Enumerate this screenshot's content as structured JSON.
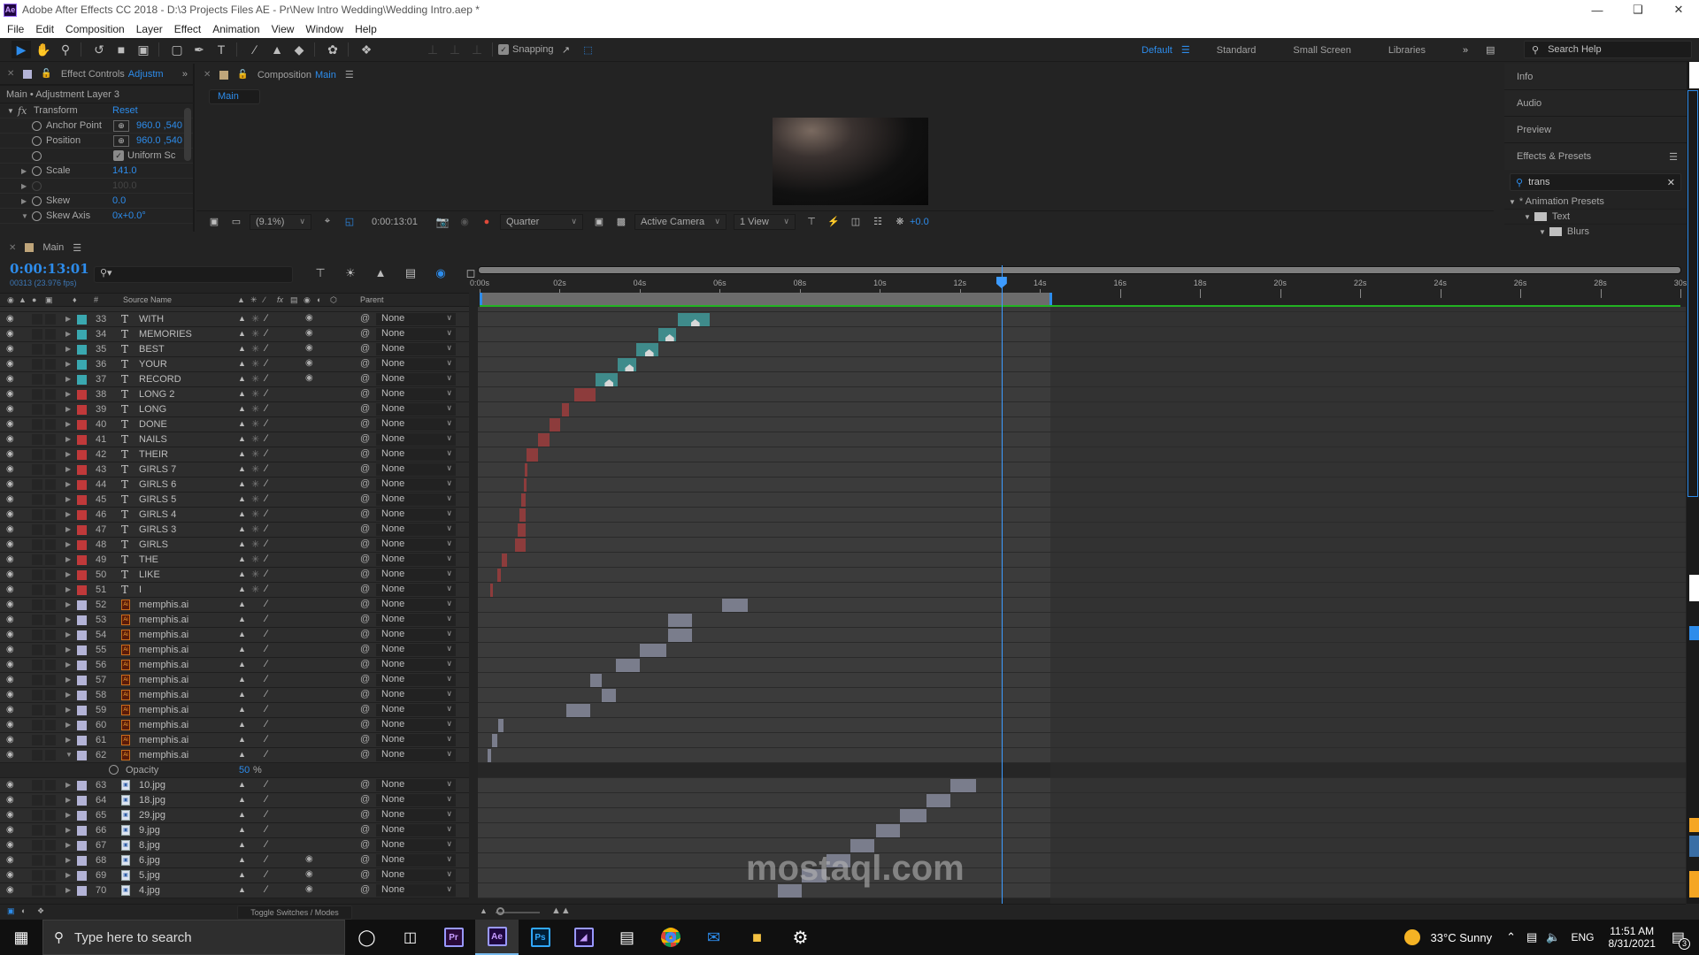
{
  "app": {
    "title": "Adobe After Effects CC 2018 - D:\\3 Projects Files AE - Pr\\New Intro Wedding\\Wedding Intro.aep *",
    "logo": "Ae"
  },
  "menu": [
    "File",
    "Edit",
    "Composition",
    "Layer",
    "Effect",
    "Animation",
    "View",
    "Window",
    "Help"
  ],
  "toolbar": {
    "snapping_label": "Snapping",
    "snapping_checked": true,
    "workspaces": [
      "Default",
      "Standard",
      "Small Screen",
      "Libraries"
    ],
    "active_workspace": "Default",
    "search_help_placeholder": "Search Help"
  },
  "effect_controls": {
    "tab_label": "Effect Controls",
    "tab_target": "Adjustm",
    "layer_path": "Main • Adjustment Layer 3",
    "effect_name": "Transform",
    "reset_label": "Reset",
    "props": [
      {
        "label": "Anchor Point",
        "value": "960.0 ,540"
      },
      {
        "label": "Position",
        "value": "960.0 ,540"
      },
      {
        "label": "",
        "value": "Uniform Sc",
        "checkbox": true
      },
      {
        "label": "Scale",
        "value": "141.0"
      },
      {
        "label": "",
        "value": "100.0"
      },
      {
        "label": "Skew",
        "value": "0.0"
      },
      {
        "label": "Skew Axis",
        "value": "0x+0.0°"
      }
    ]
  },
  "composition": {
    "tab_label": "Composition",
    "tab_target": "Main",
    "breadcrumb": "Main",
    "zoom": "(9.1%)",
    "timecode": "0:00:13:01",
    "resolution": "Quarter",
    "camera": "Active Camera",
    "views": "1 View",
    "exposure": "+0.0"
  },
  "right_panel": {
    "sections": [
      "Info",
      "Audio",
      "Preview",
      "Effects & Presets"
    ],
    "effects_search": "trans",
    "tree": [
      {
        "label": "* Animation Presets",
        "level": 0
      },
      {
        "label": "Text",
        "level": 1
      },
      {
        "label": "Blurs",
        "level": 2
      }
    ]
  },
  "timeline": {
    "tab_label": "Main",
    "timecode": "0:00:13:01",
    "frames": "00313 (23.976 fps)",
    "search_placeholder": "",
    "columns": {
      "num": "#",
      "source": "Source Name",
      "parent": "Parent"
    },
    "ruler_ticks": [
      "0:00s",
      "02s",
      "04s",
      "06s",
      "08s",
      "10s",
      "12s",
      "14s",
      "16s",
      "18s",
      "20s",
      "22s",
      "24s",
      "26s",
      "28s",
      "30s"
    ],
    "duration_s": 30,
    "current_time_s": 13.04,
    "work_area_end_s": 14.3,
    "toggle_label": "Toggle Switches / Modes",
    "layers": [
      {
        "num": "33",
        "type": "text",
        "name": "WITH",
        "color": "#3aa8b0",
        "parent": "None",
        "in": 5.0,
        "out": 5.8,
        "kind": "teal"
      },
      {
        "num": "34",
        "type": "text",
        "name": "MEMORIES",
        "color": "#3aa8b0",
        "parent": "None",
        "in": 4.5,
        "out": 4.95,
        "kind": "teal"
      },
      {
        "num": "35",
        "type": "text",
        "name": "BEST",
        "color": "#3aa8b0",
        "parent": "None",
        "in": 3.95,
        "out": 4.5,
        "kind": "teal"
      },
      {
        "num": "36",
        "type": "text",
        "name": "YOUR",
        "color": "#3aa8b0",
        "parent": "None",
        "in": 3.5,
        "out": 3.95,
        "kind": "teal"
      },
      {
        "num": "37",
        "type": "text",
        "name": "RECORD",
        "color": "#3aa8b0",
        "parent": "None",
        "in": 2.95,
        "out": 3.5,
        "kind": "teal"
      },
      {
        "num": "38",
        "type": "text",
        "name": "LONG 2",
        "color": "#c0393a",
        "parent": "None",
        "in": 2.42,
        "out": 2.93,
        "kind": "red"
      },
      {
        "num": "39",
        "type": "text",
        "name": "LONG",
        "color": "#c0393a",
        "parent": "None",
        "in": 2.1,
        "out": 2.28,
        "kind": "red"
      },
      {
        "num": "40",
        "type": "text",
        "name": "DONE",
        "color": "#c0393a",
        "parent": "None",
        "in": 1.8,
        "out": 2.05,
        "kind": "red"
      },
      {
        "num": "41",
        "type": "text",
        "name": "NAILS",
        "color": "#c0393a",
        "parent": "None",
        "in": 1.5,
        "out": 1.8,
        "kind": "red"
      },
      {
        "num": "42",
        "type": "text",
        "name": "THEIR",
        "color": "#c0393a",
        "parent": "None",
        "in": 1.22,
        "out": 1.5,
        "kind": "red"
      },
      {
        "num": "43",
        "type": "text",
        "name": "GIRLS 7",
        "color": "#c0393a",
        "parent": "None",
        "in": 1.18,
        "out": 1.22,
        "kind": "red"
      },
      {
        "num": "44",
        "type": "text",
        "name": "GIRLS 6",
        "color": "#c0393a",
        "parent": "None",
        "in": 1.14,
        "out": 1.2,
        "kind": "red"
      },
      {
        "num": "45",
        "type": "text",
        "name": "GIRLS 5",
        "color": "#c0393a",
        "parent": "None",
        "in": 1.08,
        "out": 1.2,
        "kind": "red"
      },
      {
        "num": "46",
        "type": "text",
        "name": "GIRLS 4",
        "color": "#c0393a",
        "parent": "None",
        "in": 1.04,
        "out": 1.2,
        "kind": "red"
      },
      {
        "num": "47",
        "type": "text",
        "name": "GIRLS 3",
        "color": "#c0393a",
        "parent": "None",
        "in": 0.99,
        "out": 1.2,
        "kind": "red"
      },
      {
        "num": "48",
        "type": "text",
        "name": "GIRLS",
        "color": "#c0393a",
        "parent": "None",
        "in": 0.92,
        "out": 1.2,
        "kind": "red"
      },
      {
        "num": "49",
        "type": "text",
        "name": "THE",
        "color": "#c0393a",
        "parent": "None",
        "in": 0.6,
        "out": 0.72,
        "kind": "red"
      },
      {
        "num": "50",
        "type": "text",
        "name": "LIKE",
        "color": "#c0393a",
        "parent": "None",
        "in": 0.48,
        "out": 0.58,
        "kind": "red"
      },
      {
        "num": "51",
        "type": "text",
        "name": "I",
        "color": "#c0393a",
        "parent": "None",
        "in": 0.3,
        "out": 0.36,
        "kind": "red"
      },
      {
        "num": "52",
        "type": "ai",
        "name": "memphis.ai",
        "color": "#b3b3d6",
        "parent": "None",
        "in": 6.1,
        "out": 6.75,
        "kind": "gray"
      },
      {
        "num": "53",
        "type": "ai",
        "name": "memphis.ai",
        "color": "#b3b3d6",
        "parent": "None",
        "in": 4.75,
        "out": 5.35,
        "kind": "gray"
      },
      {
        "num": "54",
        "type": "ai",
        "name": "memphis.ai",
        "color": "#b3b3d6",
        "parent": "None",
        "in": 4.75,
        "out": 5.35,
        "kind": "gray"
      },
      {
        "num": "55",
        "type": "ai",
        "name": "memphis.ai",
        "color": "#b3b3d6",
        "parent": "None",
        "in": 4.05,
        "out": 4.7,
        "kind": "gray"
      },
      {
        "num": "56",
        "type": "ai",
        "name": "memphis.ai",
        "color": "#b3b3d6",
        "parent": "None",
        "in": 3.45,
        "out": 4.05,
        "kind": "gray"
      },
      {
        "num": "57",
        "type": "ai",
        "name": "memphis.ai",
        "color": "#b3b3d6",
        "parent": "None",
        "in": 2.8,
        "out": 3.1,
        "kind": "gray"
      },
      {
        "num": "58",
        "type": "ai",
        "name": "memphis.ai",
        "color": "#b3b3d6",
        "parent": "None",
        "in": 3.1,
        "out": 3.45,
        "kind": "gray"
      },
      {
        "num": "59",
        "type": "ai",
        "name": "memphis.ai",
        "color": "#b3b3d6",
        "parent": "None",
        "in": 2.2,
        "out": 2.8,
        "kind": "gray"
      },
      {
        "num": "60",
        "type": "ai",
        "name": "memphis.ai",
        "color": "#b3b3d6",
        "parent": "None",
        "in": 0.5,
        "out": 0.65,
        "kind": "gray"
      },
      {
        "num": "61",
        "type": "ai",
        "name": "memphis.ai",
        "color": "#b3b3d6",
        "parent": "None",
        "in": 0.35,
        "out": 0.48,
        "kind": "gray"
      },
      {
        "num": "62",
        "type": "ai",
        "name": "memphis.ai",
        "color": "#b3b3d6",
        "parent": "None",
        "in": 0.25,
        "out": 0.33,
        "kind": "gray",
        "expanded": true,
        "prop": {
          "name": "Opacity",
          "value": "50",
          "unit": "%"
        }
      },
      {
        "num": "63",
        "type": "img",
        "name": "10.jpg",
        "color": "#b3b3d6",
        "parent": "None",
        "in": 11.8,
        "out": 12.45,
        "kind": "gray"
      },
      {
        "num": "64",
        "type": "img",
        "name": "18.jpg",
        "color": "#b3b3d6",
        "parent": "None",
        "in": 11.2,
        "out": 11.8,
        "kind": "gray"
      },
      {
        "num": "65",
        "type": "img",
        "name": "29.jpg",
        "color": "#b3b3d6",
        "parent": "None",
        "in": 10.55,
        "out": 11.2,
        "kind": "gray"
      },
      {
        "num": "66",
        "type": "img",
        "name": "9.jpg",
        "color": "#b3b3d6",
        "parent": "None",
        "in": 9.95,
        "out": 10.55,
        "kind": "gray"
      },
      {
        "num": "67",
        "type": "img",
        "name": "8.jpg",
        "color": "#b3b3d6",
        "parent": "None",
        "in": 9.3,
        "out": 9.9,
        "kind": "gray"
      },
      {
        "num": "68",
        "type": "img",
        "name": "6.jpg",
        "color": "#b3b3d6",
        "parent": "None",
        "in": 8.7,
        "out": 9.3,
        "kind": "gray"
      },
      {
        "num": "69",
        "type": "img",
        "name": "5.jpg",
        "color": "#b3b3d6",
        "parent": "None",
        "in": 8.1,
        "out": 8.7,
        "kind": "gray"
      },
      {
        "num": "70",
        "type": "img",
        "name": "4.jpg",
        "color": "#b3b3d6",
        "parent": "None",
        "in": 7.5,
        "out": 8.1,
        "kind": "gray"
      }
    ]
  },
  "taskbar": {
    "search_placeholder": "Type here to search",
    "apps": [
      {
        "name": "Pr",
        "color": "#9999ff",
        "bg": "#2a0a3a"
      },
      {
        "name": "Ae",
        "color": "#9999ff",
        "bg": "#1f0740",
        "active": true
      },
      {
        "name": "Ps",
        "color": "#31a8ff",
        "bg": "#001e36"
      },
      {
        "name": "Me",
        "color": "#9999ff",
        "bg": "#1a0a3a"
      }
    ],
    "weather": "33°C  Sunny",
    "language": "ENG",
    "time": "11:51 AM",
    "date": "8/31/2021",
    "notifications": "3"
  },
  "watermark": "mostaql.com"
}
